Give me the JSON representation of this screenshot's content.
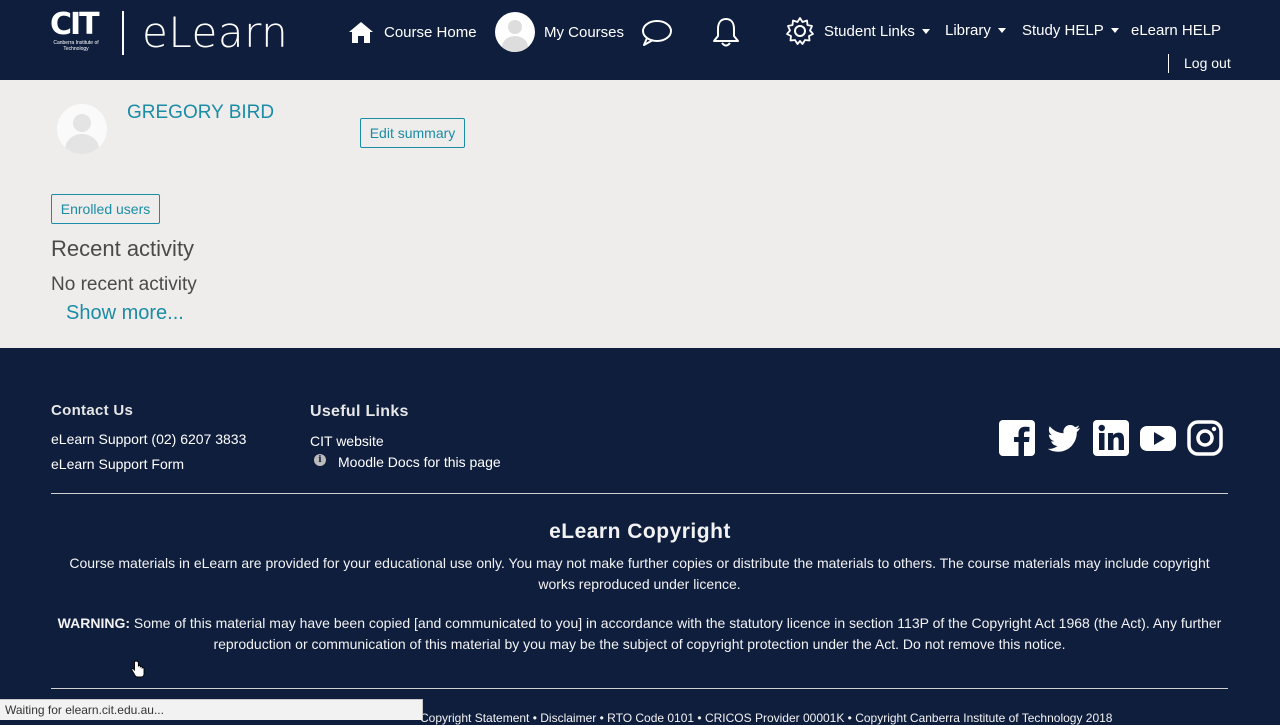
{
  "header": {
    "logo": {
      "mark": "CIT",
      "mark_sub": "Canberra Institute of Technology",
      "product": "eLearn"
    },
    "nav": {
      "course_home": "Course Home",
      "my_courses": "My Courses",
      "student_links": "Student Links",
      "library": "Library",
      "study_help": "Study HELP",
      "elearn_help": "eLearn HELP",
      "logout": "Log out"
    }
  },
  "profile": {
    "name": "GREGORY BIRD",
    "edit_summary": "Edit summary",
    "enrolled_users": "Enrolled users",
    "recent_activity_title": "Recent activity",
    "no_recent_activity": "No recent activity",
    "show_more": "Show more..."
  },
  "footer": {
    "contact": {
      "heading": "Contact Us",
      "support_phone": "eLearn Support (02) 6207 3833",
      "support_form": "eLearn Support Form"
    },
    "useful_links": {
      "heading": "Useful Links",
      "cit_website": "CIT website",
      "moodle_docs": "Moodle Docs for this page"
    },
    "socials": [
      "facebook-icon",
      "twitter-icon",
      "linkedin-icon",
      "youtube-icon",
      "instagram-icon"
    ],
    "copyright": {
      "title": "eLearn Copyright",
      "paragraph": "Course materials in eLearn are provided for your educational use only. You may not make further copies or distribute the materials to others. The course materials may include copyright works reproduced under licence.",
      "warning_label": "WARNING:",
      "warning_text": " Some of this material may have been copied [and communicated to you] in accordance with the statutory licence in section 113P of the Copyright Act 1968 (the Act). Any further reproduction or communication of this material by you may be the subject of copyright protection under the Act. Do not remove this notice."
    },
    "bottom_line": "Copyright Statement • Disclaimer • RTO Code 0101 • CRICOS Provider 00001K • Copyright Canberra Institute of Technology 2018"
  },
  "browser": {
    "status": "Waiting for elearn.cit.edu.au..."
  },
  "colors": {
    "navy": "#0f1e3d",
    "accent": "#1b8ca6",
    "content_bg": "#eeedeb"
  }
}
